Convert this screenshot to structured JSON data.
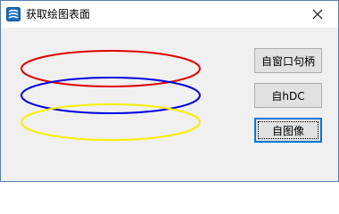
{
  "window": {
    "title": "获取绘图表面",
    "close_symbol": "✕"
  },
  "buttons": [
    {
      "label": "自窗口句柄"
    },
    {
      "label": "自hDC"
    },
    {
      "label": "自图像"
    }
  ],
  "canvas": {
    "ellipses": [
      {
        "color": "#e00000"
      },
      {
        "color": "#0000e0"
      },
      {
        "color": "#f5f000"
      }
    ]
  },
  "colors": {
    "window_background": "#f0f0f0",
    "titlebar_background": "#ffffff",
    "button_background": "#e1e1e1",
    "button_border": "#adadad",
    "focus_accent": "#0078d7"
  }
}
